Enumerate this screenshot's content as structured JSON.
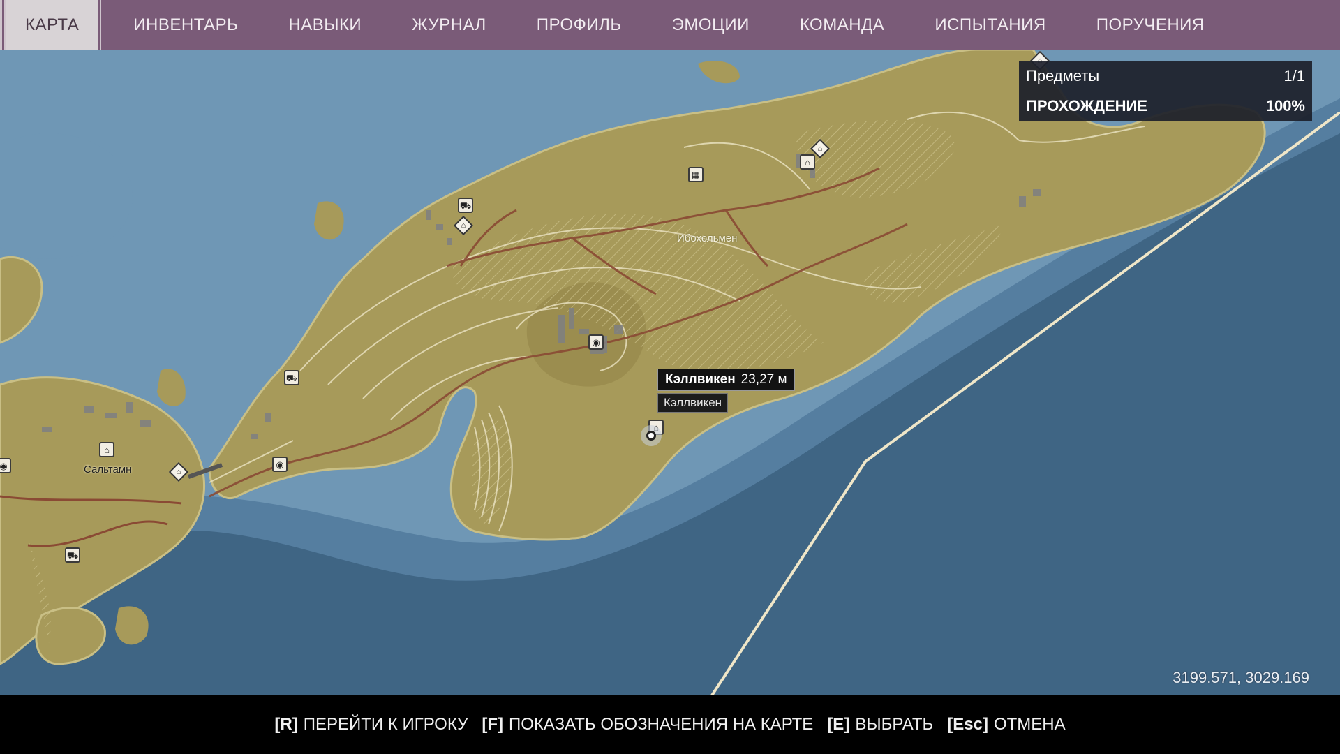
{
  "nav": {
    "tabs": [
      {
        "label": "КАРТА",
        "active": true
      },
      {
        "label": "ИНВЕНТАРЬ"
      },
      {
        "label": "НАВЫКИ"
      },
      {
        "label": "ЖУРНАЛ"
      },
      {
        "label": "ПРОФИЛЬ"
      },
      {
        "label": "ЭМОЦИИ"
      },
      {
        "label": "КОМАНДА"
      },
      {
        "label": "ИСПЫТАНИЯ"
      },
      {
        "label": "ПОРУЧЕНИЯ"
      }
    ]
  },
  "map": {
    "labels": {
      "island": "Ибохольмен",
      "town": "Сальтамн"
    },
    "tooltip": {
      "name": "Кэллвикен",
      "distance": "23,27 м",
      "subtitle": "Кэллвикен"
    },
    "coordinates": "3199.571, 3029.169"
  },
  "objectives": {
    "items_label": "Предметы",
    "items_value": "1/1",
    "completion_label": "ПРОХОЖДЕНИЕ",
    "completion_value": "100%"
  },
  "footer": {
    "hints": [
      {
        "key": "[R]",
        "label": "ПЕРЕЙТИ К ИГРОКУ"
      },
      {
        "key": "[F]",
        "label": "ПОКАЗАТЬ ОБОЗНАЧЕНИЯ НА КАРТЕ"
      },
      {
        "key": "[E]",
        "label": "ВЫБРАТЬ"
      },
      {
        "key": "[Esc]",
        "label": "ОТМЕНА"
      }
    ]
  },
  "colors": {
    "nav_bg": "#7a5b78",
    "deep_water": "#3f6584",
    "shallow_water": "#6f97b5",
    "land": "#a79a5a",
    "road": "#8a4a34",
    "boundary": "#efe6c8"
  },
  "icons": [
    "camera-icon",
    "tractor-icon",
    "home-diamond-icon",
    "factory-icon",
    "building-icon",
    "player-marker-icon"
  ]
}
